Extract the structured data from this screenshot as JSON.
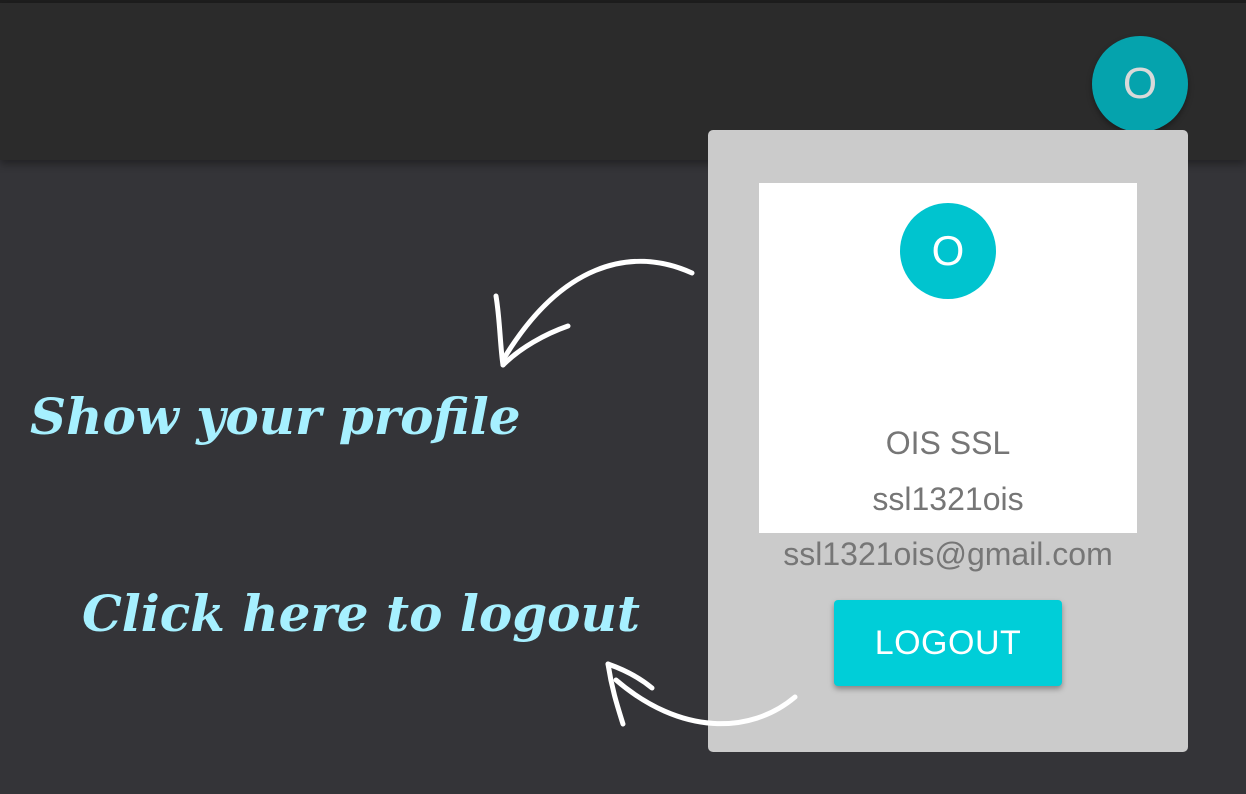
{
  "app_bar": {
    "avatar_initial": "O"
  },
  "profile_menu": {
    "avatar_initial": "O",
    "name": "OIS SSL",
    "username": "ssl1321ois",
    "email": "ssl1321ois@gmail.com",
    "logout_label": "LOGOUT"
  },
  "annotations": {
    "profile_hint": "Show your profile",
    "logout_hint": "Click here to logout"
  },
  "colors": {
    "background": "#343438",
    "app_bar": "#2b2b2b",
    "accent": "#00ced8",
    "panel": "#cbcbcb",
    "annotation_text": "#a6f0ff"
  },
  "icons": {
    "arrow_to_profile": "curved-arrow-icon",
    "arrow_to_logout": "curved-arrow-icon"
  }
}
